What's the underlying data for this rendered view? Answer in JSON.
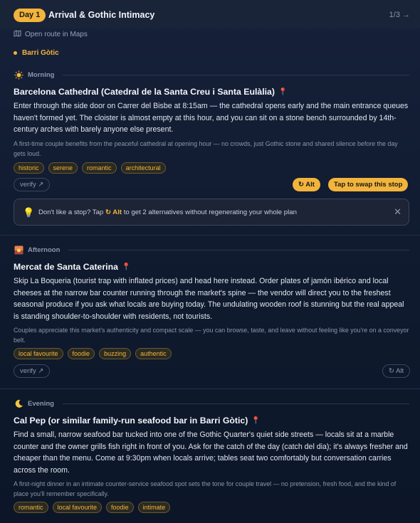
{
  "header": {
    "day_badge": "Day 1",
    "title": "Arrival & Gothic Intimacy",
    "pager": "1/3 →"
  },
  "maps_link": {
    "icon": "map-icon",
    "label": "Open route in Maps"
  },
  "area": {
    "label": "Barri Gòtic",
    "color": "#f2b43b"
  },
  "banner": {
    "icon": "lightbulb-icon",
    "text_before": "Don't like a stop? Tap",
    "alt_label": "↻ Alt",
    "text_after": "to get 2 alternatives without regenerating your whole plan",
    "close": "✕"
  },
  "stops": [
    {
      "slot": "Morning",
      "slot_icon": "sun-icon",
      "title": "Barcelona Cathedral (Catedral de la Santa Creu i Santa Eulàlia)",
      "description": "Enter through the side door on Carrer del Bisbe at 8:15am — the cathedral opens early and the main entrance queues haven't formed yet. The cloister is almost empty at this hour, and you can sit on a stone bench surrounded by 14th-century arches with barely anyone else present.",
      "note": "A first-time couple benefits from the peaceful cathedral at opening hour — no crowds, just Gothic stone and shared silence before the day gets loud.",
      "tags": [
        "historic",
        "serene",
        "romantic",
        "architectural"
      ],
      "verify": "verify ↗",
      "alt": "↻ Alt",
      "swap_tip": "Tap to swap this stop"
    },
    {
      "slot": "Afternoon",
      "slot_icon": "sunset-icon",
      "title": "Mercat de Santa Caterina",
      "description": "Skip La Boqueria (tourist trap with inflated prices) and head here instead. Order plates of jamón ibérico and local cheeses at the narrow bar counter running through the market's spine — the vendor will direct you to the freshest seasonal produce if you ask what locals are buying today. The undulating wooden roof is stunning but the real appeal is standing shoulder-to-shoulder with residents, not tourists.",
      "note": "Couples appreciate this market's authenticity and compact scale — you can browse, taste, and leave without feeling like you're on a conveyor belt.",
      "tags": [
        "local favourite",
        "foodie",
        "buzzing",
        "authentic"
      ],
      "verify": "verify ↗",
      "alt": "↻ Alt"
    },
    {
      "slot": "Evening",
      "slot_icon": "moon-icon",
      "title": "Cal Pep (or similar family-run seafood bar in Barri Gòtic)",
      "description": "Find a small, narrow seafood bar tucked into one of the Gothic Quarter's quiet side streets — locals sit at a marble counter and the owner grills fish right in front of you. Ask for the catch of the day (catch del dia); it's always fresher and cheaper than the menu. Come at 9:30pm when locals arrive; tables seat two comfortably but conversation carries across the room.",
      "note": "A first-night dinner in an intimate counter-service seafood spot sets the tone for couple travel — no pretension, fresh food, and the kind of place you'll remember specifically.",
      "tags": [
        "romantic",
        "local favourite",
        "foodie",
        "intimate"
      ]
    }
  ]
}
